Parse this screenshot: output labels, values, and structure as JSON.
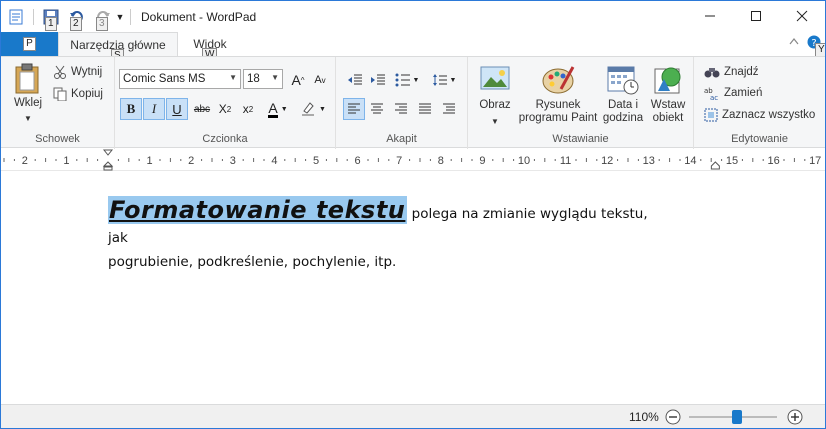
{
  "window": {
    "title": "Dokument - WordPad",
    "qat_keytips": [
      "1",
      "2",
      "3"
    ],
    "controls": {
      "minimize": "minimize",
      "maximize": "maximize",
      "close": "close"
    }
  },
  "tabs": {
    "file": {
      "keytip": "P"
    },
    "home": {
      "label": "Narzędzia główne",
      "keytip": "S"
    },
    "view": {
      "label": "Widok",
      "keytip": "W"
    },
    "help_keytip": "Y"
  },
  "ribbon": {
    "clipboard": {
      "group_label": "Schowek",
      "paste": "Wklej",
      "cut": "Wytnij",
      "copy": "Kopiuj"
    },
    "font": {
      "group_label": "Czcionka",
      "family": "Comic Sans MS",
      "size": "18"
    },
    "paragraph": {
      "group_label": "Akapit"
    },
    "insert": {
      "group_label": "Wstawianie",
      "picture": "Obraz",
      "paint_line1": "Rysunek",
      "paint_line2": "programu Paint",
      "datetime_line1": "Data i",
      "datetime_line2": "godzina",
      "object_line1": "Wstaw",
      "object_line2": "obiekt"
    },
    "editing": {
      "group_label": "Edytowanie",
      "find": "Znajdź",
      "replace": "Zamień",
      "select_all": "Zaznacz wszystko"
    }
  },
  "ruler": {
    "labels": [
      "2",
      "1",
      "1",
      "2",
      "3",
      "4",
      "5",
      "6",
      "7",
      "8",
      "9",
      "10",
      "11",
      "12",
      "13",
      "14",
      "15",
      "16",
      "17"
    ]
  },
  "document": {
    "heading": "Formatowanie tekstu",
    "line1_rest": " polega na zmianie wyglądu tekstu, jak",
    "line2": "pogrubienie, podkreślenie, pochylenie, itp."
  },
  "status": {
    "zoom": "110%",
    "zoom_level_percent": 110
  },
  "colors": {
    "accent": "#1979ca",
    "selection": "#99c9ef"
  }
}
